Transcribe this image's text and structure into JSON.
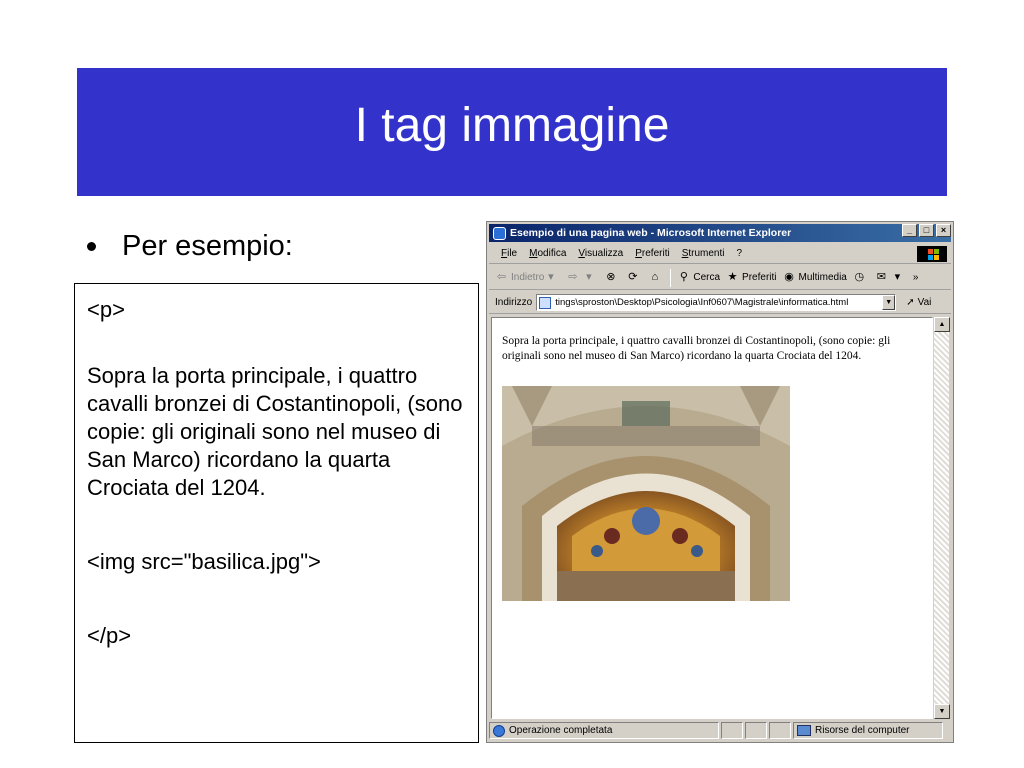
{
  "slide": {
    "title": "I tag immagine",
    "bullet": "Per esempio:"
  },
  "code": {
    "open_tag": "<p>",
    "paragraph": "Sopra la porta principale, i quattro cavalli bronzei di Costantinopoli, (sono copie: gli originali sono nel museo di San Marco) ricordano la quarta Crociata del 1204.",
    "img_tag": "<img src=\"basilica.jpg\">",
    "close_tag": "</p>"
  },
  "browser": {
    "title": "Esempio di una pagina web - Microsoft Internet Explorer",
    "window_buttons": [
      "_",
      "□",
      "×"
    ],
    "menu": [
      "File",
      "Modifica",
      "Visualizza",
      "Preferiti",
      "Strumenti",
      "?"
    ],
    "toolbar": {
      "back": "Indietro",
      "search": "Cerca",
      "favorites": "Preferiti",
      "multimedia": "Multimedia",
      "more": "»"
    },
    "address": {
      "label": "Indirizzo",
      "value": "tings\\sproston\\Desktop\\Psicologia\\Inf0607\\Magistrale\\informatica.html",
      "go": "Vai"
    },
    "page_text": "Sopra la porta principale, i quattro cavalli bronzei di Costantinopoli, (sono copie: gli originali sono nel museo di San Marco) ricordano la quarta Crociata del 1204.",
    "status": {
      "message": "Operazione completata",
      "zone": "Risorse del computer"
    }
  },
  "colors": {
    "banner": "#3333cc",
    "titlebar_start": "#0a246a",
    "titlebar_end": "#3a6ea5",
    "chrome": "#d4d0c8"
  }
}
